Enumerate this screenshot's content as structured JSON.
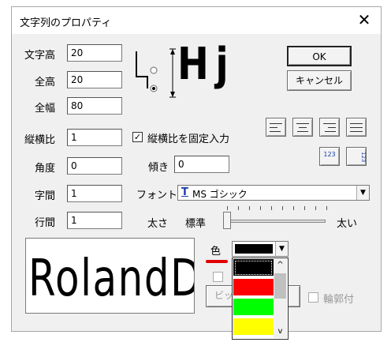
{
  "window": {
    "title": "文字列のプロパティ",
    "close_glyph": "✕"
  },
  "fields": {
    "char_height": {
      "label": "文字高",
      "value": "20"
    },
    "total_height": {
      "label": "全高",
      "value": "20"
    },
    "total_width": {
      "label": "全幅",
      "value": "80"
    },
    "aspect_ratio": {
      "label": "縦横比",
      "value": "1"
    },
    "angle": {
      "label": "角度",
      "value": "0"
    },
    "slant": {
      "label": "傾き",
      "value": "0"
    },
    "char_spacing": {
      "label": "字間",
      "value": "1"
    },
    "line_spacing": {
      "label": "行間",
      "value": "1"
    }
  },
  "illustration": {
    "sample": "Hj"
  },
  "buttons": {
    "ok": "OK",
    "cancel": "キャンセル",
    "bitmap": "ビッ"
  },
  "fixed_ratio": {
    "label": "縦横比を固定入力",
    "checked": true,
    "check_glyph": "✓"
  },
  "font": {
    "label": "フォント",
    "icon_glyph": "T",
    "value": "MS ゴシック"
  },
  "weight": {
    "label": "太さ",
    "left": "標準",
    "right": "太い",
    "level": 0
  },
  "color": {
    "label": "色",
    "selected": "#000000",
    "options": [
      "#000000",
      "#ff0000",
      "#00ff00",
      "#ffff00"
    ]
  },
  "outline": {
    "label": "輪郭付"
  },
  "preview": {
    "text": "RolandDG"
  },
  "icons": {
    "number_horizontal": "123",
    "number_vertical": "123",
    "dropdown_arrow": "▼",
    "scroll_up": "^",
    "scroll_down": "v"
  }
}
